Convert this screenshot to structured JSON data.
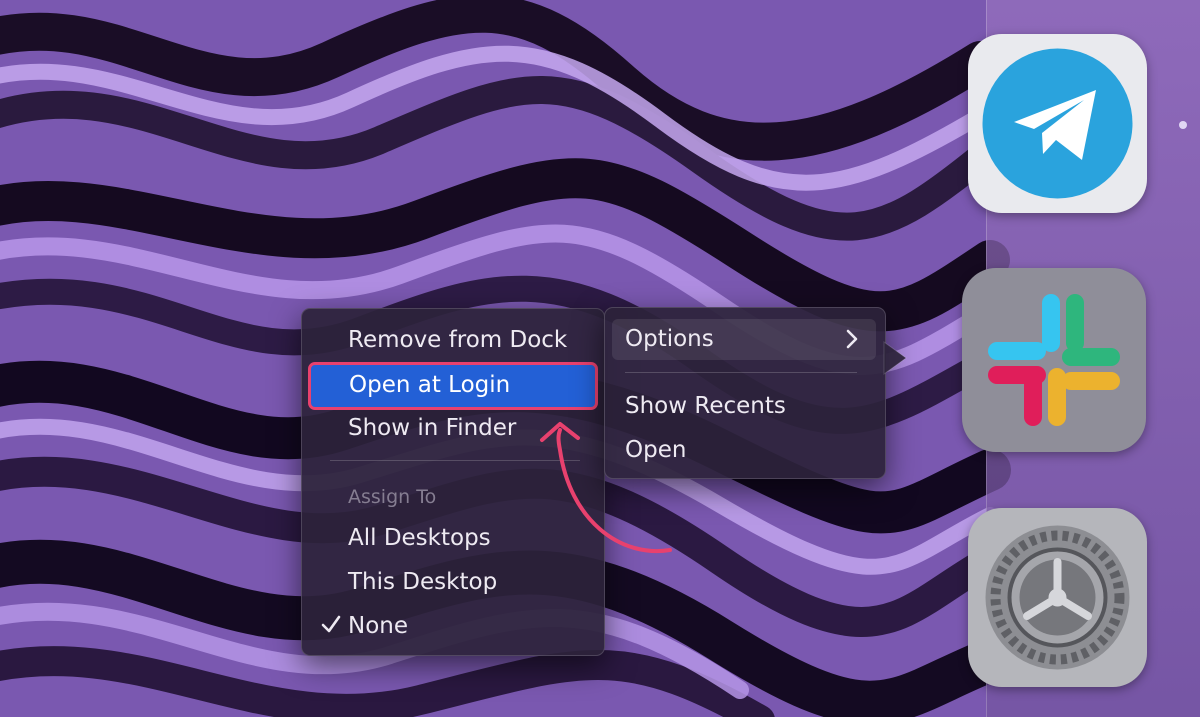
{
  "context_menu": {
    "items": [
      {
        "label": "Remove from Dock"
      },
      {
        "label": "Open at Login"
      },
      {
        "label": "Show in Finder"
      }
    ],
    "assign_to_heading": "Assign To",
    "assign_options": [
      {
        "label": "All Desktops"
      },
      {
        "label": "This Desktop"
      },
      {
        "label": "None",
        "checked": true
      }
    ],
    "options_label": "Options"
  },
  "submenu": {
    "items": [
      {
        "label": "Show Recents"
      },
      {
        "label": "Open"
      }
    ]
  },
  "dock": {
    "apps": [
      {
        "icon": "telegram-icon"
      },
      {
        "icon": "slack-icon"
      },
      {
        "icon": "system-settings-icon"
      }
    ]
  },
  "colors": {
    "highlight": "#2360d6",
    "annotation": "#e8416e",
    "wallpaper_accent": "#9f7cd9"
  }
}
